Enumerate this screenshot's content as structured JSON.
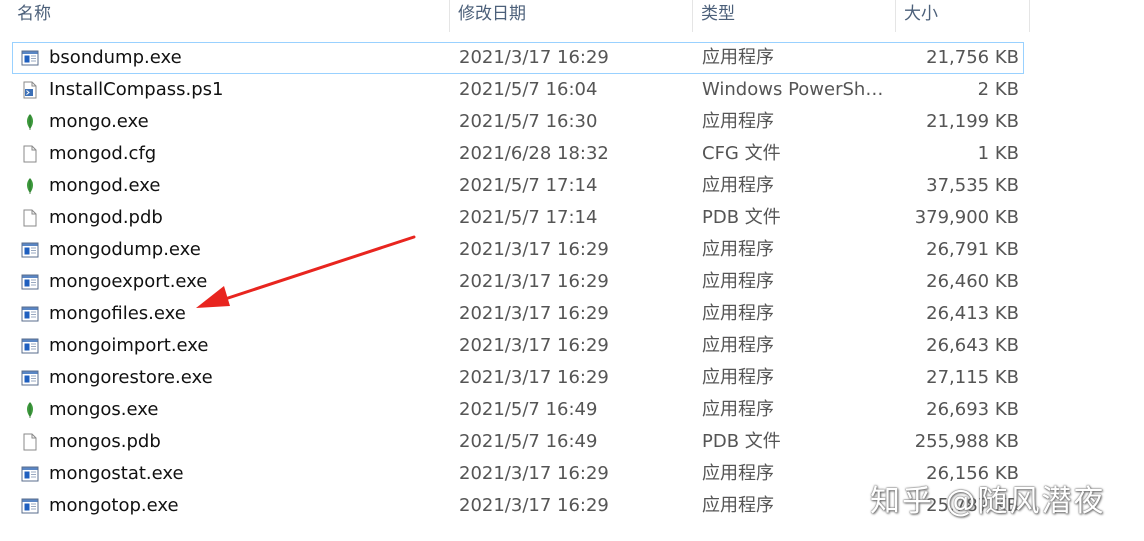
{
  "columns": {
    "name": "名称",
    "date": "修改日期",
    "type": "类型",
    "size": "大小"
  },
  "files": [
    {
      "name": "bsondump.exe",
      "date": "2021/3/17 16:29",
      "type": "应用程序",
      "size": "21,756 KB",
      "icon": "app-window-icon"
    },
    {
      "name": "InstallCompass.ps1",
      "date": "2021/5/7 16:04",
      "type": "Windows PowerShe...",
      "size": "2 KB",
      "icon": "powershell-script-icon"
    },
    {
      "name": "mongo.exe",
      "date": "2021/5/7 16:30",
      "type": "应用程序",
      "size": "21,199 KB",
      "icon": "mongodb-leaf-icon"
    },
    {
      "name": "mongod.cfg",
      "date": "2021/6/28 18:32",
      "type": "CFG 文件",
      "size": "1 KB",
      "icon": "blank-file-icon"
    },
    {
      "name": "mongod.exe",
      "date": "2021/5/7 17:14",
      "type": "应用程序",
      "size": "37,535 KB",
      "icon": "mongodb-leaf-icon"
    },
    {
      "name": "mongod.pdb",
      "date": "2021/5/7 17:14",
      "type": "PDB 文件",
      "size": "379,900 KB",
      "icon": "blank-file-icon"
    },
    {
      "name": "mongodump.exe",
      "date": "2021/3/17 16:29",
      "type": "应用程序",
      "size": "26,791 KB",
      "icon": "app-window-icon"
    },
    {
      "name": "mongoexport.exe",
      "date": "2021/3/17 16:29",
      "type": "应用程序",
      "size": "26,460 KB",
      "icon": "app-window-icon"
    },
    {
      "name": "mongofiles.exe",
      "date": "2021/3/17 16:29",
      "type": "应用程序",
      "size": "26,413 KB",
      "icon": "app-window-icon"
    },
    {
      "name": "mongoimport.exe",
      "date": "2021/3/17 16:29",
      "type": "应用程序",
      "size": "26,643 KB",
      "icon": "app-window-icon"
    },
    {
      "name": "mongorestore.exe",
      "date": "2021/3/17 16:29",
      "type": "应用程序",
      "size": "27,115 KB",
      "icon": "app-window-icon"
    },
    {
      "name": "mongos.exe",
      "date": "2021/5/7 16:49",
      "type": "应用程序",
      "size": "26,693 KB",
      "icon": "mongodb-leaf-icon"
    },
    {
      "name": "mongos.pdb",
      "date": "2021/5/7 16:49",
      "type": "PDB 文件",
      "size": "255,988 KB",
      "icon": "blank-file-icon"
    },
    {
      "name": "mongostat.exe",
      "date": "2021/3/17 16:29",
      "type": "应用程序",
      "size": "26,156 KB",
      "icon": "app-window-icon"
    },
    {
      "name": "mongotop.exe",
      "date": "2021/3/17 16:29",
      "type": "应用程序",
      "size": "25,787 KB",
      "icon": "app-window-icon"
    }
  ],
  "selected_index": 0,
  "annotation": {
    "arrow_color": "#e8251f",
    "points_to": "mongofiles.exe"
  },
  "watermark": "知乎 @随风潜夜",
  "colors": {
    "header_text": "#4c607a",
    "selection_border": "#99d1ff",
    "leaf_green": "#3c9a3c",
    "app_blue": "#1f5fbf"
  }
}
